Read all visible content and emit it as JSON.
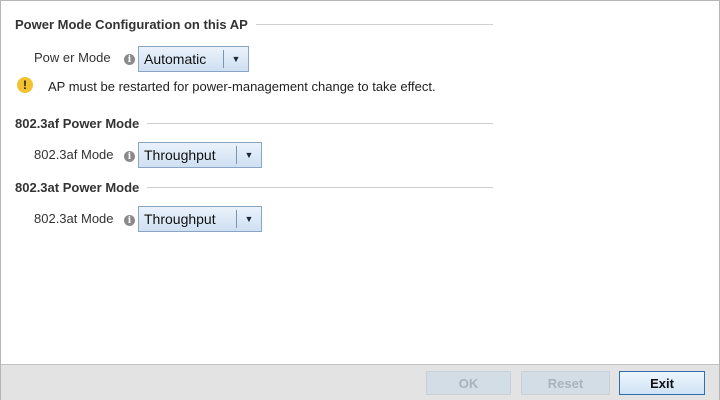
{
  "sections": {
    "power_mode": {
      "title": "Power Mode Configuration on this AP",
      "field_label": "Pow er Mode",
      "select_value": "Automatic",
      "warning": "AP must be restarted for power-management change to take effect."
    },
    "af": {
      "title": "802.3af Power Mode",
      "field_label": "802.3af Mode",
      "select_value": "Throughput"
    },
    "at": {
      "title": "802.3at Power Mode",
      "field_label": "802.3at Mode",
      "select_value": "Throughput"
    }
  },
  "footer": {
    "ok_label": "OK",
    "reset_label": "Reset",
    "exit_label": "Exit"
  },
  "colors": {
    "accent": "#2d6fb0",
    "warning": "#f2c230",
    "disabled_button": "#d3dde6"
  },
  "icons": {
    "info": "info-icon",
    "warning": "warning-icon",
    "dropdown": "chevron-down-icon"
  }
}
